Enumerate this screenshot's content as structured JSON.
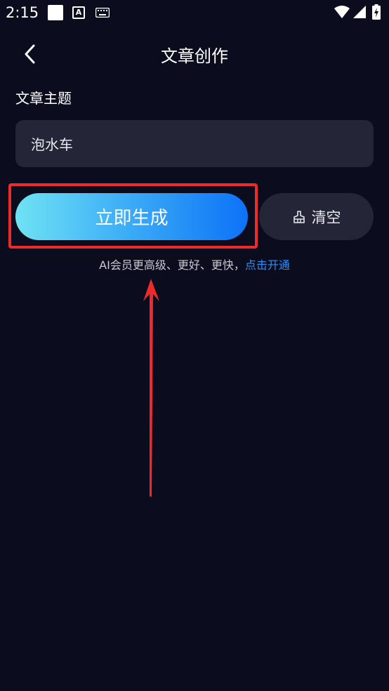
{
  "status_bar": {
    "time": "2:15"
  },
  "header": {
    "title": "文章创作"
  },
  "form": {
    "topic_label": "文章主题",
    "topic_value": "泡水车"
  },
  "actions": {
    "generate_label": "立即生成",
    "clear_label": "清空"
  },
  "vip": {
    "text": "AI会员更高级、更好、更快，",
    "link": "点击开通"
  },
  "colors": {
    "background": "#0b0c1e",
    "input_bg": "#252538",
    "gradient_start": "#6fe2f4",
    "gradient_end": "#0d72f7",
    "link": "#2e8ff6",
    "annotation": "#ee2a2a"
  },
  "icons": {
    "back": "chevron-left-icon",
    "clear": "broom-icon"
  }
}
